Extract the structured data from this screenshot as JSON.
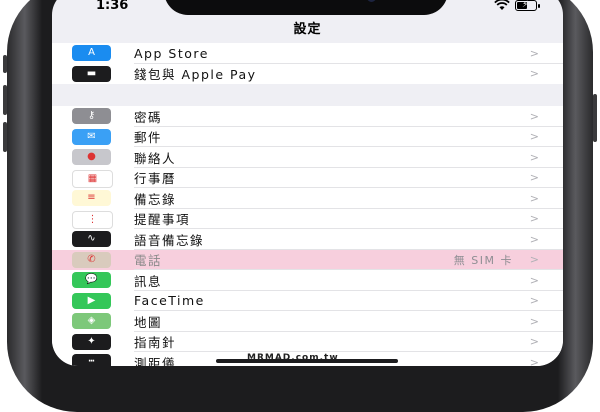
{
  "status_bar": {
    "time": "1:36"
  },
  "nav": {
    "title": "設定"
  },
  "group1": [
    {
      "label": "App Store",
      "icon": "app-store-icon",
      "color": "#1a8cf0",
      "glyph": "A",
      "value": ""
    },
    {
      "label": "錢包與 Apple Pay",
      "icon": "wallet-icon",
      "color": "#1c1c1e",
      "glyph": "▬",
      "value": ""
    }
  ],
  "group2": [
    {
      "label": "密碼",
      "icon": "key-icon",
      "color": "#8e8e93",
      "glyph": "⚷",
      "value": ""
    },
    {
      "label": "郵件",
      "icon": "mail-icon",
      "color": "#3aa0f5",
      "glyph": "✉",
      "value": ""
    },
    {
      "label": "聯絡人",
      "icon": "contacts-icon",
      "color": "#c7c7cc",
      "glyph": "●",
      "value": ""
    },
    {
      "label": "行事曆",
      "icon": "calendar-icon",
      "color": "#ffffff",
      "glyph": "▦",
      "value": ""
    },
    {
      "label": "備忘錄",
      "icon": "notes-icon",
      "color": "#fff8d6",
      "glyph": "≡",
      "value": ""
    },
    {
      "label": "提醒事項",
      "icon": "reminders-icon",
      "color": "#ffffff",
      "glyph": "⋮",
      "value": ""
    },
    {
      "label": "語音備忘錄",
      "icon": "voice-memos-icon",
      "color": "#1c1c1e",
      "glyph": "∿",
      "value": ""
    },
    {
      "label": "電話",
      "icon": "phone-icon",
      "color": "#d9cbbd",
      "glyph": "✆",
      "value": "無 SIM 卡",
      "highlight": true
    },
    {
      "label": "訊息",
      "icon": "messages-icon",
      "color": "#34c759",
      "glyph": "💬",
      "value": ""
    },
    {
      "label": "FaceTime",
      "icon": "facetime-icon",
      "color": "#34c759",
      "glyph": "▶",
      "value": ""
    },
    {
      "label": "地圖",
      "icon": "maps-icon",
      "color": "#7dc87a",
      "glyph": "◈",
      "value": ""
    },
    {
      "label": "指南針",
      "icon": "compass-icon",
      "color": "#1c1c1e",
      "glyph": "✦",
      "value": ""
    },
    {
      "label": "測距儀",
      "icon": "measure-icon",
      "color": "#1c1c1e",
      "glyph": "┅",
      "value": ""
    }
  ],
  "chevron": ">",
  "watermark": "MRMAD.com.tw"
}
